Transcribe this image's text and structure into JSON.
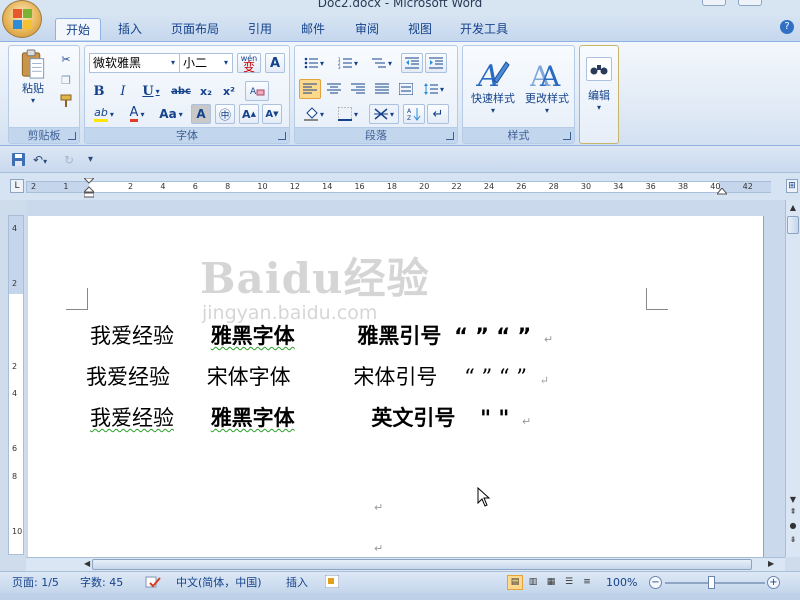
{
  "window": {
    "title": "Doc2.docx - Microsoft Word"
  },
  "tabs": [
    "开始",
    "插入",
    "页面布局",
    "引用",
    "邮件",
    "审阅",
    "视图",
    "开发工具"
  ],
  "active_tab": "开始",
  "ribbon": {
    "clipboard": {
      "label": "剪贴板",
      "paste_label": "粘贴"
    },
    "font": {
      "label": "字体",
      "font_name": "微软雅黑",
      "font_size": "小二",
      "wen_label": "wén\n变",
      "bold": "B",
      "italic": "I",
      "underline": "U",
      "strike": "abc",
      "subscript": "x₂",
      "superscript": "x²",
      "aa": "Aa",
      "highlight_letters": "ab",
      "font_color_letter": "A"
    },
    "paragraph": {
      "label": "段落"
    },
    "styles": {
      "label": "样式",
      "quick_styles": "快速样式",
      "change_styles": "更改样式"
    },
    "editing": {
      "label": "编辑"
    }
  },
  "document": {
    "lines": [
      {
        "a": "我爱经验",
        "b": "雅黑字体",
        "c": "雅黑引号",
        "q": "“ ”  “ ”"
      },
      {
        "a": "我爱经验",
        "b": "宋体字体",
        "c": "宋体引号",
        "q": "“ ”  “ ”"
      },
      {
        "a": "我爱经验",
        "b": "雅黑字体",
        "c": "英文引号",
        "q": "\" \""
      }
    ],
    "paragraph_mark": "↵"
  },
  "watermark": {
    "logo": "Baidu经验",
    "url": "jingyan.baidu.com"
  },
  "ruler": {
    "h_ticks": [
      "2",
      "1",
      "",
      "2",
      "4",
      "6",
      "8",
      "10",
      "12",
      "14",
      "16",
      "18",
      "20",
      "22",
      "24",
      "26",
      "28",
      "30",
      "34",
      "36",
      "38",
      "40",
      "42"
    ],
    "v_ticks": [
      "4",
      "",
      "2",
      "",
      "",
      "2",
      "4",
      "",
      "6",
      "8",
      "",
      "10"
    ]
  },
  "status": {
    "page": "页面: 1/5",
    "words": "字数: 45",
    "language": "中文(简体，中国)",
    "insert": "插入",
    "zoom": "100%",
    "zoom_level": 1.0
  },
  "colors": {
    "accent": "#15428b",
    "ribbon_bg": "#dfe9f5",
    "highlight": "#fcd98c",
    "squiggle": "#2aa02a"
  }
}
